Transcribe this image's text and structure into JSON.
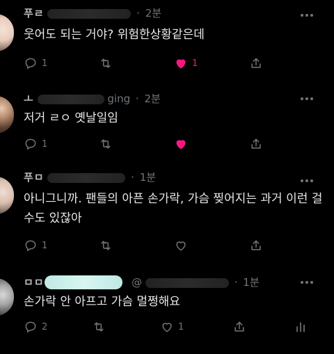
{
  "tweets": [
    {
      "name": "푸ㄹ",
      "handle": "",
      "time": "2분",
      "text": "웃어도 되는 거야? 위험한상황같은데",
      "replies": "1",
      "likes": "1",
      "liked": true
    },
    {
      "name": "ㅗ",
      "handle": "ging",
      "time": "2분",
      "text": "저거 ㄹㅇ 옛날일임",
      "replies": "1",
      "likes": "",
      "liked": true
    },
    {
      "name": "푸ㅁ",
      "handle": "",
      "time": "1분",
      "text": "아니그니까. 팬들의 아픈 손가락, 가슴 찢어지는 과거 이런 걸수도 있잖아",
      "replies": "1",
      "likes": "",
      "liked": false
    },
    {
      "name": "ㅁㅁ",
      "handle": "@",
      "time": "1분",
      "text": "손가락 안 아프고 가슴 멀쩡해요",
      "replies": "2",
      "likes": "1",
      "liked": false
    }
  ],
  "colors": {
    "background": "#000000",
    "text": "#e7e9ea",
    "muted": "#71767b",
    "like_active": "#f91880",
    "redaction_mint": "#c9eee9"
  },
  "icons": [
    "reply-icon",
    "retweet-icon",
    "like-icon",
    "share-icon",
    "analytics-icon",
    "more-icon"
  ]
}
